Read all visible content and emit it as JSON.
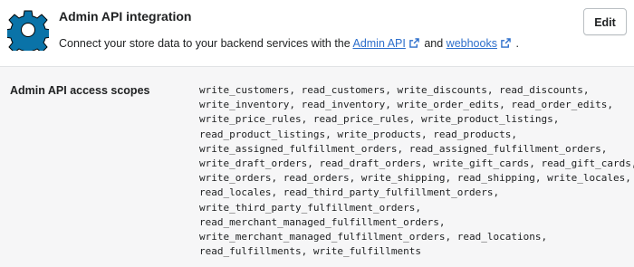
{
  "header": {
    "title": "Admin API integration",
    "description_prefix": "Connect your store data to your backend services with the ",
    "admin_api_link": "Admin API",
    "description_middle": " and ",
    "webhooks_link": "webhooks",
    "description_suffix": " .",
    "edit_label": "Edit",
    "gear_color": "#0a73a8",
    "link_color": "#2c6ecb"
  },
  "scopes": {
    "label": "Admin API access scopes",
    "lines": [
      "write_customers, read_customers, write_discounts, read_discounts,",
      "write_inventory, read_inventory, write_order_edits, read_order_edits,",
      "write_price_rules, read_price_rules, write_product_listings,",
      "read_product_listings, write_products, read_products,",
      "write_assigned_fulfillment_orders, read_assigned_fulfillment_orders,",
      "write_draft_orders, read_draft_orders, write_gift_cards, read_gift_cards,",
      "write_orders, read_orders, write_shipping, read_shipping, write_locales,",
      "read_locales, read_third_party_fulfillment_orders,",
      "write_third_party_fulfillment_orders,",
      "read_merchant_managed_fulfillment_orders,",
      "write_merchant_managed_fulfillment_orders, read_locations,",
      "read_fulfillments, write_fulfillments"
    ]
  }
}
